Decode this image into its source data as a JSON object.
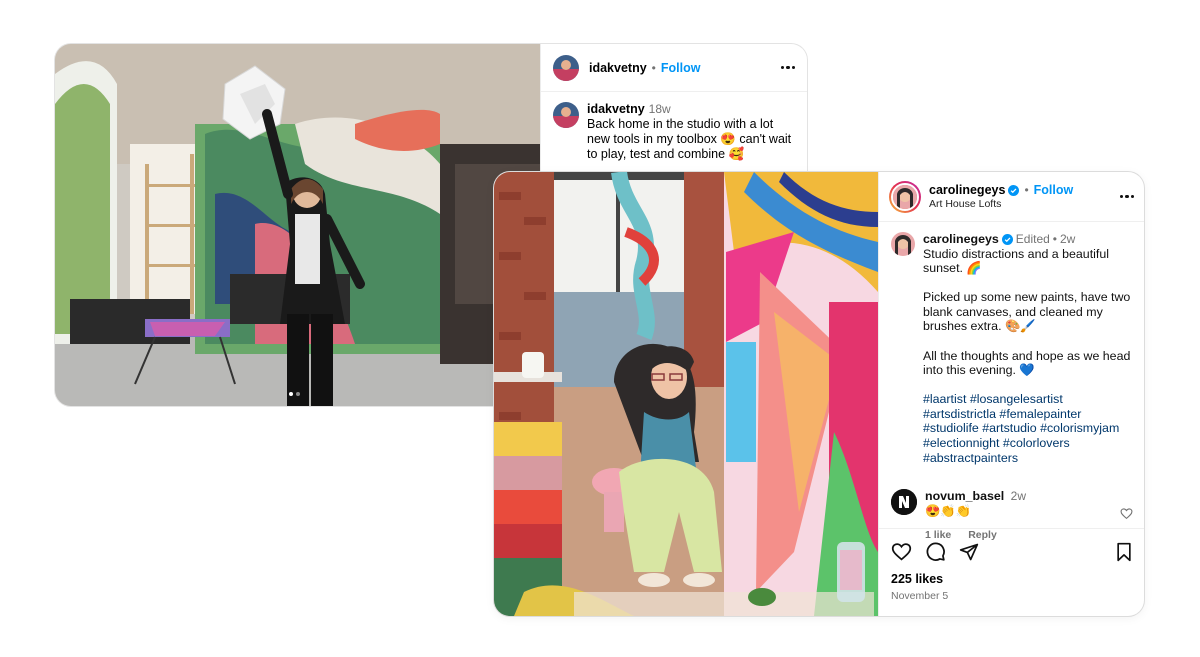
{
  "post_back": {
    "username": "idakvetny",
    "follow_label": "Follow",
    "dot": "•",
    "caption_username": "idakvetny",
    "caption_time": "18w",
    "caption_text": "Back home in the studio with a lot new tools in my toolbox 😍 can't wait to play, test and combine 🥰"
  },
  "post_front": {
    "username": "carolinegeys",
    "follow_label": "Follow",
    "dot": "•",
    "location": "Art House Lofts",
    "caption_username": "carolinegeys",
    "edited_label": "Edited",
    "caption_time": "2w",
    "caption_p1": "Studio distractions and a beautiful sunset. 🌈",
    "caption_p2": "Picked up some new paints, have two blank canvases, and cleaned my brushes extra. 🎨🖌️",
    "caption_p3": "All the thoughts and hope as we head into this evening. 💙",
    "hashtags": "#laartist #losangelesartist #artsdistrictla #femalepainter #studiolife #artstudio #colorismyjam #electionnight #colorlovers #abstractpainters",
    "comment": {
      "username": "novum_basel",
      "time": "2w",
      "text": "😍👏👏",
      "likes": "1 like",
      "reply_label": "Reply"
    },
    "likes_label": "225 likes",
    "date": "November 5"
  },
  "colors": {
    "accent": "#0095f6",
    "hashtag": "#00376b",
    "verified": "#0095f6"
  },
  "icons": [
    "more-icon",
    "verified-icon",
    "heart-icon",
    "comment-icon",
    "share-icon",
    "bookmark-icon"
  ]
}
